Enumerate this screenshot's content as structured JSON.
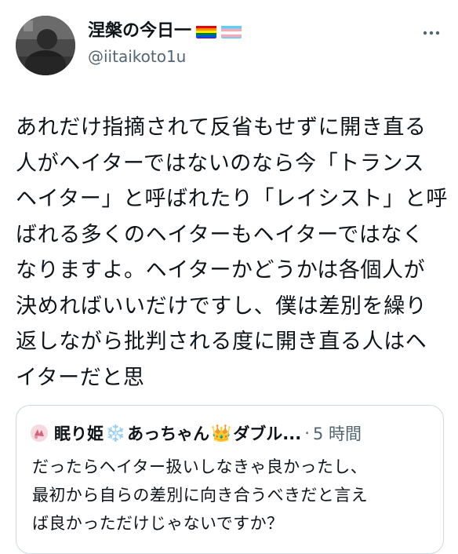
{
  "author": {
    "display_name": "涅槃の今日一",
    "handle": "@iitaikoto1u",
    "flags": [
      "rainbow-flag-icon",
      "transgender-flag-icon"
    ]
  },
  "tweet": {
    "lines": [
      "あれだけ指摘されて反省もせずに開き直る",
      "人がヘイターではないのなら今「トランス",
      "ヘイター」と呼ばれたり「レイシスト」と呼",
      "ばれる多くのヘイターもヘイターではなく",
      "なりますよ。ヘイターかどうかは各個人が",
      "決めればいいだけですし、僕は差別を繰り",
      "返しながら批判される度に開き直る人はヘ",
      "イターだと思"
    ]
  },
  "quote": {
    "name_part1": "眠り姫",
    "emoji1": "❄️",
    "name_part2": "あっちゃん",
    "emoji2": "👑",
    "name_part3": "ダブル...",
    "separator": "·",
    "time": "5 時間",
    "lines": [
      "だったらヘイター扱いしなきゃ良かったし、",
      "最初から自らの差別に向き合うべきだと言え",
      "ば良かっただけじゃないですか？"
    ]
  },
  "colors": {
    "text": "#0f1419",
    "secondary": "#536471",
    "border": "#cfd9de"
  }
}
